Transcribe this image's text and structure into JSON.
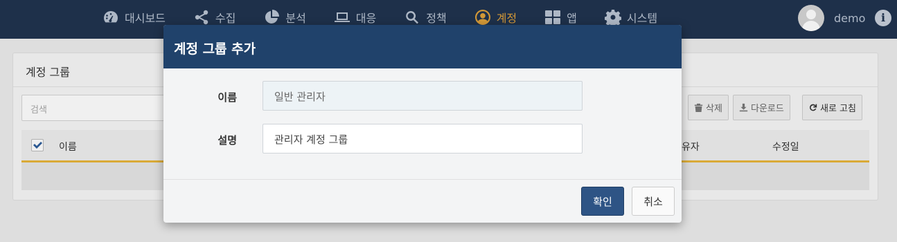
{
  "nav": {
    "items": [
      {
        "label": "대시보드",
        "icon": "dashboard-icon"
      },
      {
        "label": "수집",
        "icon": "share-icon"
      },
      {
        "label": "분석",
        "icon": "pie-chart-icon"
      },
      {
        "label": "대응",
        "icon": "laptop-icon"
      },
      {
        "label": "정책",
        "icon": "search-icon"
      },
      {
        "label": "계정",
        "icon": "user-circle-icon",
        "active": true
      },
      {
        "label": "앱",
        "icon": "apps-grid-icon"
      },
      {
        "label": "시스템",
        "icon": "gear-icon"
      }
    ],
    "user": "demo",
    "info_glyph": "i",
    "colors": {
      "bar": "#20334f",
      "text": "#b9c4d3",
      "active": "#e0a23b"
    }
  },
  "page": {
    "title": "계정 그룹",
    "search_placeholder": "검색",
    "delete_label": "삭제",
    "download_label": "다운로드",
    "refresh_label": "새로 고침",
    "columns": {
      "name": "이름",
      "owner_fragment": "유자",
      "modified": "수정일"
    }
  },
  "modal": {
    "title": "계정 그룹 추가",
    "name_label": "이름",
    "name_value": "일반 관리자",
    "desc_label": "설명",
    "desc_value": "관리자 계정 그룹",
    "confirm_label": "확인",
    "cancel_label": "취소",
    "colors": {
      "header": "#20426b",
      "primary": "#2e5485"
    }
  }
}
